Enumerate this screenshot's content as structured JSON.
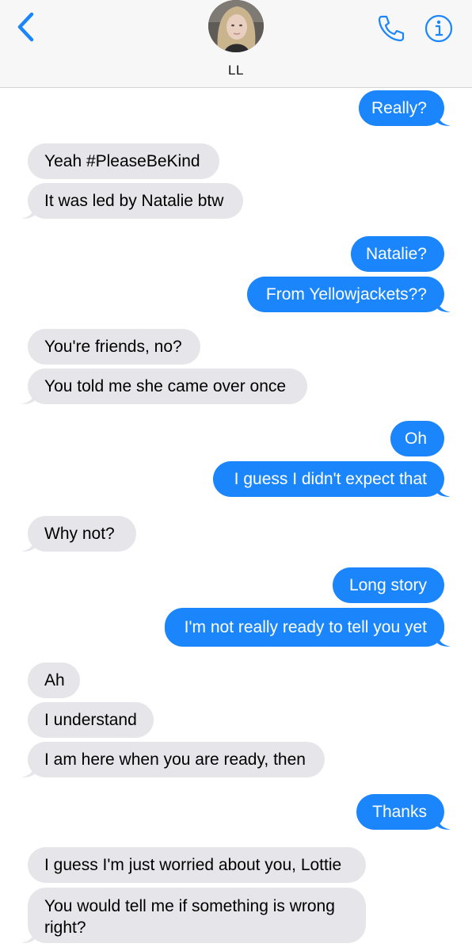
{
  "header": {
    "contact_name": "LL"
  },
  "icons": {
    "back": "chevron-left-icon",
    "call": "phone-icon",
    "info": "info-icon"
  },
  "colors": {
    "sent_bubble": "#1b86fb",
    "received_bubble": "#e6e5ea",
    "accent": "#1b86fb"
  },
  "messages": [
    {
      "from": "me",
      "text": "Really?"
    },
    {
      "from": "them",
      "text": "Yeah #PleaseBeKind"
    },
    {
      "from": "them",
      "text": "It was led by Natalie btw"
    },
    {
      "from": "me",
      "text": "Natalie?"
    },
    {
      "from": "me",
      "text": "From Yellowjackets??"
    },
    {
      "from": "them",
      "text": "You're friends, no?"
    },
    {
      "from": "them",
      "text": "You told me she came over once"
    },
    {
      "from": "me",
      "text": "Oh"
    },
    {
      "from": "me",
      "text": "I guess I didn't expect that"
    },
    {
      "from": "them",
      "text": "Why not?"
    },
    {
      "from": "me",
      "text": "Long story"
    },
    {
      "from": "me",
      "text": "I'm not really ready to tell you yet"
    },
    {
      "from": "them",
      "text": "Ah"
    },
    {
      "from": "them",
      "text": "I understand"
    },
    {
      "from": "them",
      "text": "I am here when you are ready, then"
    },
    {
      "from": "me",
      "text": "Thanks"
    },
    {
      "from": "them",
      "text": "I guess I'm just worried about you, Lottie"
    },
    {
      "from": "them",
      "text": "You would tell me if something is wrong right?"
    }
  ]
}
